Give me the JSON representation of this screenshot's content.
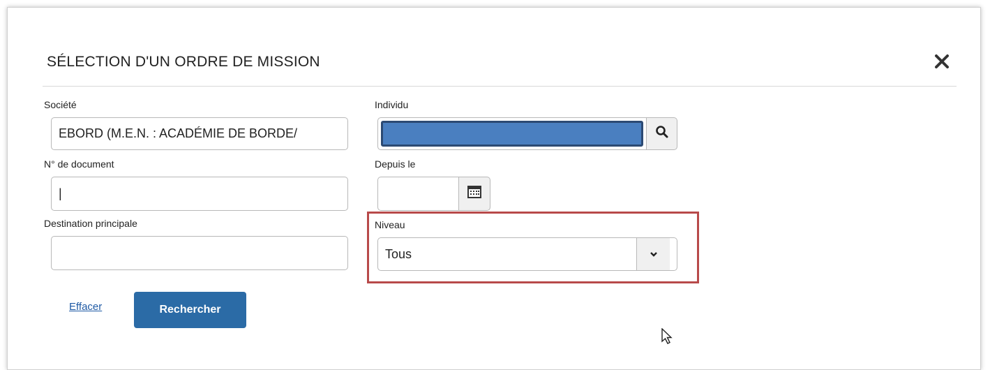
{
  "dialog": {
    "title": "SÉLECTION D'UN ORDRE DE MISSION",
    "close_icon": "close-icon"
  },
  "form": {
    "societe": {
      "label": "Société",
      "value": "EBORD (M.E.N. : ACADÉMIE DE BORDE/"
    },
    "individu": {
      "label": "Individu",
      "value": "",
      "search_icon": "search-icon"
    },
    "n_document": {
      "label": "N° de document",
      "value": "|"
    },
    "depuis_le": {
      "label": "Depuis le",
      "value": "",
      "calendar_icon": "calendar-icon"
    },
    "destination": {
      "label": "Destination principale",
      "value": ""
    },
    "niveau": {
      "label": "Niveau",
      "value": "Tous",
      "dropdown_icon": "chevron-down-icon"
    }
  },
  "actions": {
    "clear_label": "Effacer",
    "search_label": "Rechercher"
  },
  "colors": {
    "primary": "#2b6ba6",
    "highlight": "#b84a4a",
    "redacted": "#4a7fc0",
    "link": "#1f5aa5"
  }
}
